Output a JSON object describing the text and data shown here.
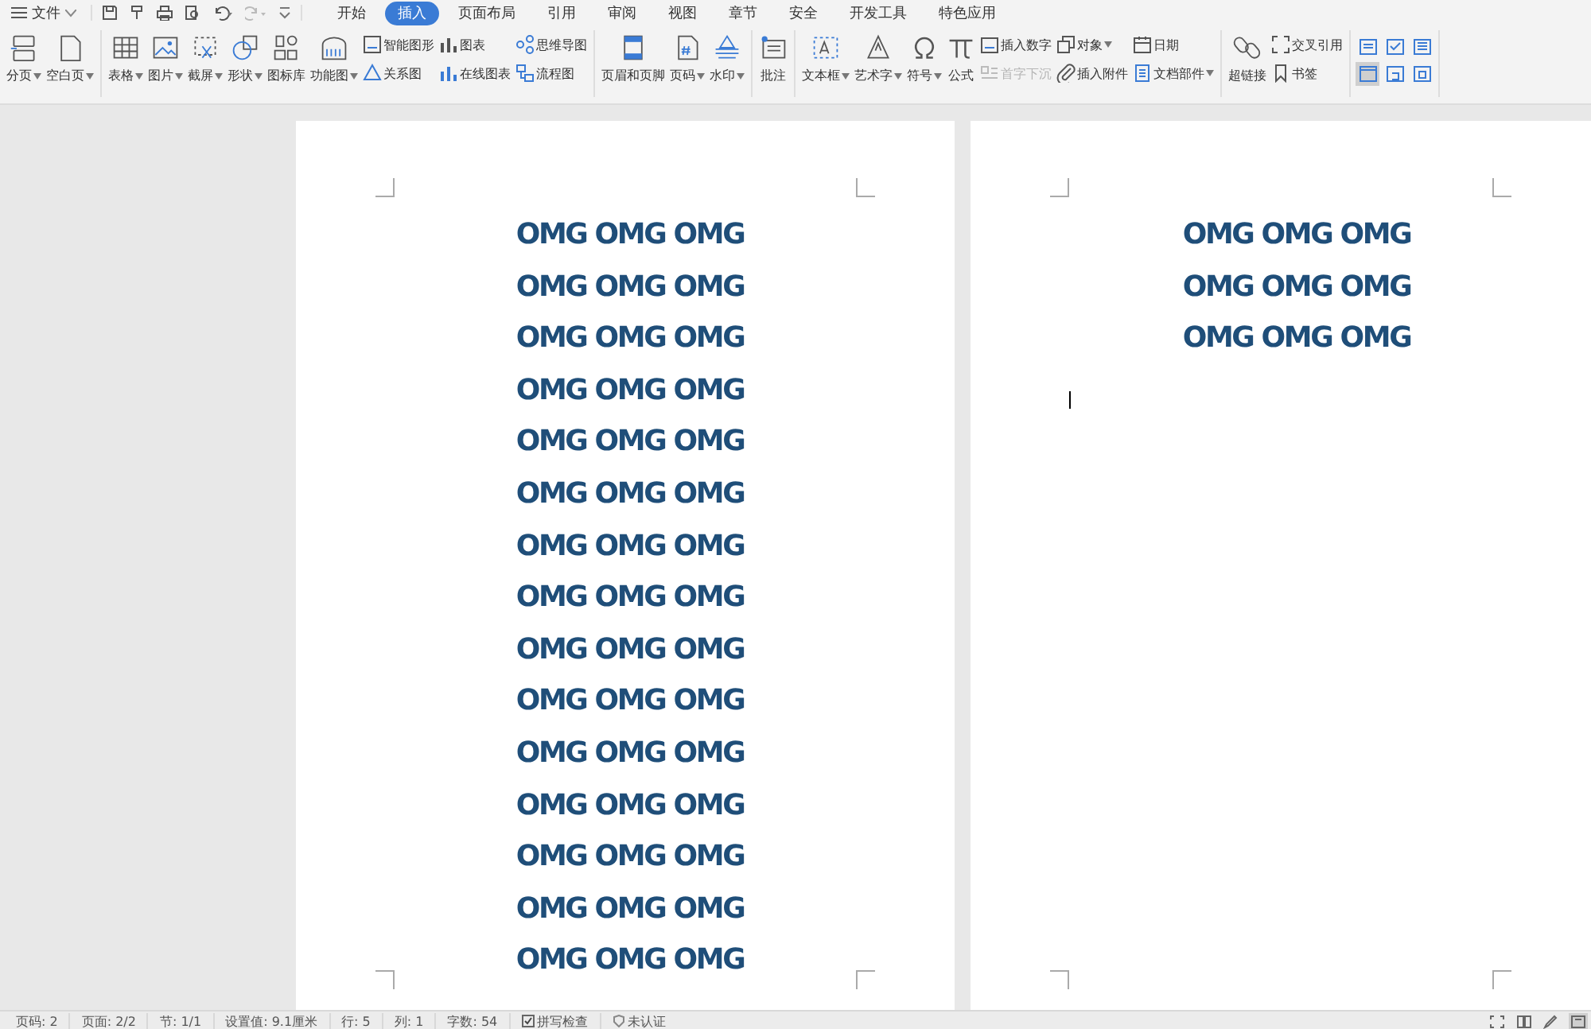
{
  "file_menu": {
    "label": "文件"
  },
  "tabs": [
    {
      "label": "开始",
      "selected": false
    },
    {
      "label": "插入",
      "selected": true
    },
    {
      "label": "页面布局",
      "selected": false
    },
    {
      "label": "引用",
      "selected": false
    },
    {
      "label": "审阅",
      "selected": false
    },
    {
      "label": "视图",
      "selected": false
    },
    {
      "label": "章节",
      "selected": false
    },
    {
      "label": "安全",
      "selected": false
    },
    {
      "label": "开发工具",
      "selected": false
    },
    {
      "label": "特色应用",
      "selected": false
    }
  ],
  "ribbon": [
    [
      {
        "kind": "large",
        "label": "分页",
        "dropdown": true
      },
      {
        "kind": "large",
        "label": "空白页",
        "dropdown": true
      }
    ],
    [
      {
        "kind": "large",
        "label": "表格",
        "dropdown": true
      },
      {
        "kind": "large",
        "label": "图片",
        "dropdown": true
      },
      {
        "kind": "large",
        "label": "截屏",
        "dropdown": true
      },
      {
        "kind": "large",
        "label": "形状",
        "dropdown": true
      },
      {
        "kind": "large",
        "label": "图标库",
        "dropdown": false
      },
      {
        "kind": "large",
        "label": "功能图",
        "dropdown": true
      },
      {
        "kind": "stack",
        "items": [
          {
            "label": "智能图形",
            "dropdown": false,
            "disabled": false
          },
          {
            "label": "关系图",
            "dropdown": false,
            "disabled": false
          }
        ]
      },
      {
        "kind": "stack",
        "items": [
          {
            "label": "图表",
            "dropdown": false,
            "disabled": false
          },
          {
            "label": "在线图表",
            "dropdown": false,
            "disabled": false
          }
        ]
      },
      {
        "kind": "stack",
        "items": [
          {
            "label": "思维导图",
            "dropdown": false,
            "disabled": false
          },
          {
            "label": "流程图",
            "dropdown": false,
            "disabled": false
          }
        ]
      }
    ],
    [
      {
        "kind": "large",
        "label": "页眉和页脚",
        "dropdown": false
      },
      {
        "kind": "large",
        "label": "页码",
        "dropdown": true
      },
      {
        "kind": "large",
        "label": "水印",
        "dropdown": true
      }
    ],
    [
      {
        "kind": "large",
        "label": "批注",
        "dropdown": false
      }
    ],
    [
      {
        "kind": "large",
        "label": "文本框",
        "dropdown": true
      },
      {
        "kind": "large",
        "label": "艺术字",
        "dropdown": true
      },
      {
        "kind": "large",
        "label": "符号",
        "dropdown": true
      },
      {
        "kind": "large",
        "label": "公式",
        "dropdown": false
      },
      {
        "kind": "stack",
        "items": [
          {
            "label": "插入数字",
            "dropdown": false,
            "disabled": false
          },
          {
            "label": "首字下沉",
            "dropdown": false,
            "disabled": true
          }
        ]
      },
      {
        "kind": "stack",
        "items": [
          {
            "label": "对象",
            "dropdown": true,
            "disabled": false
          },
          {
            "label": "插入附件",
            "dropdown": false,
            "disabled": false
          }
        ]
      },
      {
        "kind": "stack",
        "items": [
          {
            "label": "日期",
            "dropdown": false,
            "disabled": false
          },
          {
            "label": "文档部件",
            "dropdown": true,
            "disabled": false
          }
        ]
      }
    ],
    [
      {
        "kind": "large",
        "label": "超链接",
        "dropdown": false
      },
      {
        "kind": "stack",
        "items": [
          {
            "label": "交叉引用",
            "dropdown": false,
            "disabled": false
          },
          {
            "label": "书签",
            "dropdown": false,
            "disabled": false
          }
        ]
      }
    ],
    [
      {
        "kind": "grid",
        "items": [
          {
            "selected": false
          },
          {
            "selected": false
          },
          {
            "selected": false
          },
          {
            "selected": true
          },
          {
            "selected": false
          },
          {
            "selected": false
          }
        ]
      }
    ]
  ],
  "pages": [
    {
      "cursor": false,
      "lines": [
        "OMG OMG OMG",
        "OMG OMG OMG",
        "OMG OMG OMG",
        "OMG OMG OMG",
        "OMG OMG OMG",
        "OMG OMG OMG",
        "OMG OMG OMG",
        "OMG OMG OMG",
        "OMG OMG OMG",
        "OMG OMG OMG",
        "OMG OMG OMG",
        "OMG OMG OMG",
        "OMG OMG OMG",
        "OMG OMG OMG",
        "OMG OMG OMG"
      ]
    },
    {
      "cursor": true,
      "lines": [
        "OMG OMG OMG",
        "OMG OMG OMG",
        "OMG OMG OMG"
      ]
    }
  ],
  "status_bar": [
    {
      "kind": "text",
      "label": "页码: 2"
    },
    {
      "kind": "text",
      "label": "页面: 2/2"
    },
    {
      "kind": "text",
      "label": "节: 1/1"
    },
    {
      "kind": "text",
      "label": "设置值: 9.1厘米"
    },
    {
      "kind": "text",
      "label": "行: 5"
    },
    {
      "kind": "text",
      "label": "列: 1"
    },
    {
      "kind": "text",
      "label": "字数: 54"
    },
    {
      "kind": "checkbox",
      "label": "拼写检查",
      "checked": true
    },
    {
      "kind": "shield",
      "label": "未认证"
    }
  ],
  "view_buttons": [
    {
      "selected": false
    },
    {
      "selected": false
    },
    {
      "selected": false
    },
    {
      "selected": true
    }
  ]
}
